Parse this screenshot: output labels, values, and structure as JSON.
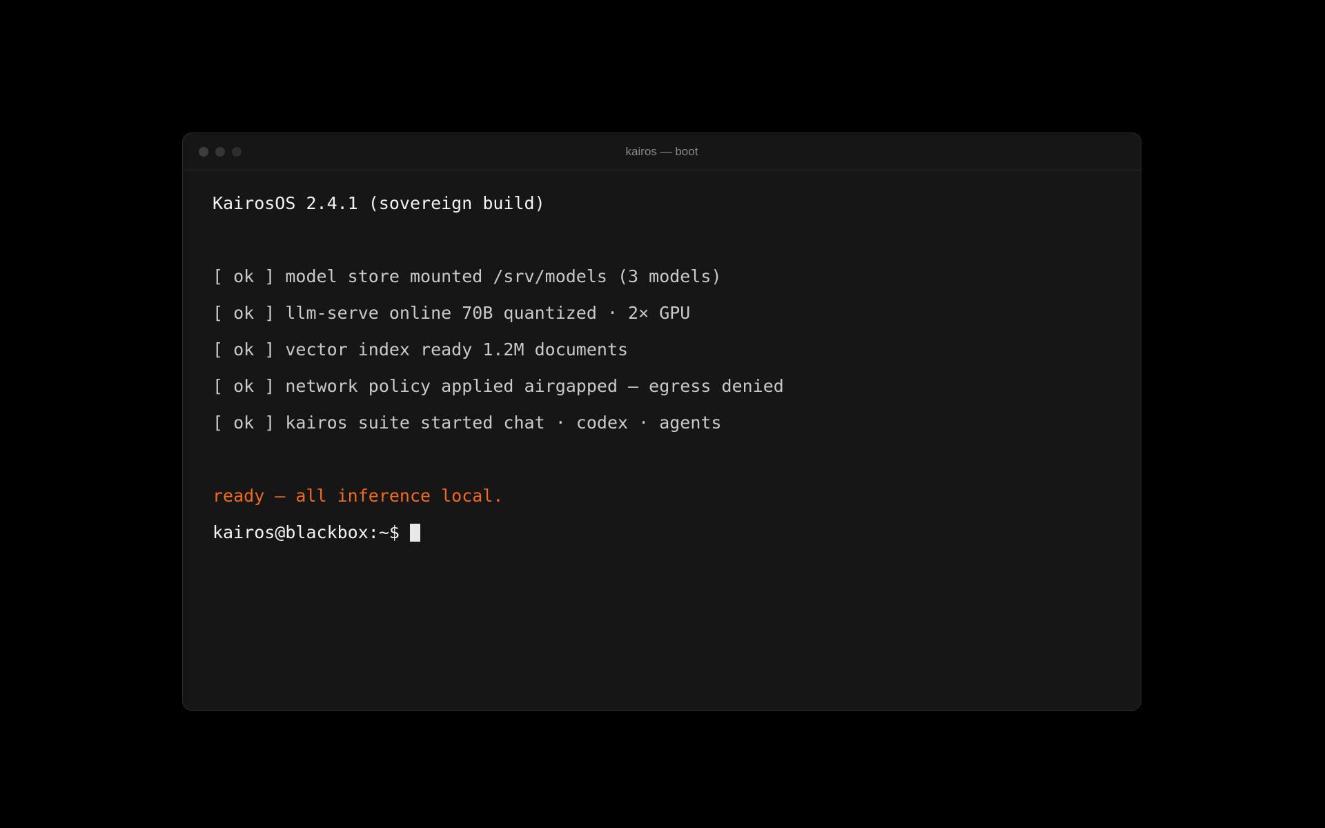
{
  "window": {
    "title": "kairos — boot"
  },
  "terminal": {
    "header": "KairosOS 2.4.1 (sovereign build)",
    "boot_lines": [
      "[ ok ] model store mounted /srv/models (3 models)",
      "[ ok ] llm-serve online 70B quantized · 2× GPU",
      "[ ok ] vector index ready 1.2M documents",
      "[ ok ] network policy applied airgapped — egress denied",
      "[ ok ] kairos suite started chat · codex · agents"
    ],
    "ready_message": "ready — all inference local.",
    "prompt": "kairos@blackbox:~$ "
  },
  "colors": {
    "background": "#000000",
    "window": "#161616",
    "accent": "#f26b1d",
    "text": "#f2f2f2",
    "muted_text": "#c9c9c9"
  },
  "icons": [
    "close-light",
    "minimize-light",
    "zoom-light",
    "cursor-block"
  ]
}
